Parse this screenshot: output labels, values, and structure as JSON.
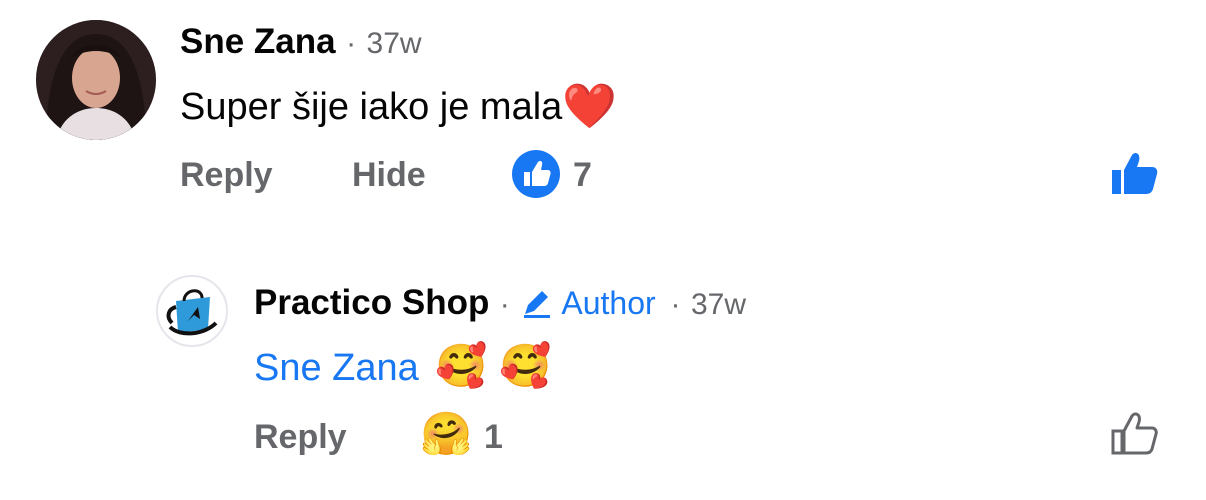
{
  "comment1": {
    "author": "Sne Zana",
    "time": "37w",
    "text": "Super šije iako je mala",
    "emoji": "❤️",
    "reply_label": "Reply",
    "hide_label": "Hide",
    "like_count": "7"
  },
  "reply1": {
    "author": "Practico Shop",
    "badge": "Author",
    "time": "37w",
    "mention": "Sne Zana",
    "emojis": "🥰 🥰",
    "reply_label": "Reply",
    "reaction_emoji": "🤗",
    "reaction_count": "1"
  },
  "separator": "·",
  "colors": {
    "brand_blue": "#1877f2",
    "meta_gray": "#65676b",
    "text": "#050505"
  }
}
